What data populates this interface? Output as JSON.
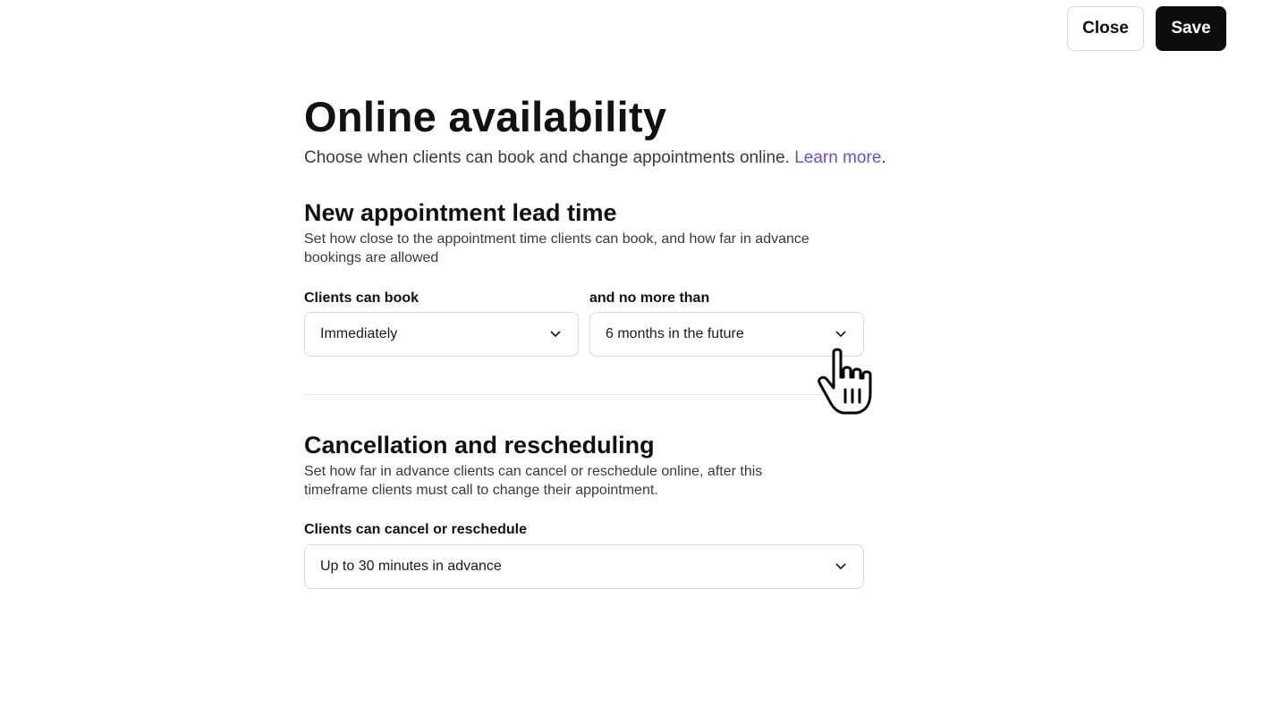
{
  "header": {
    "close_label": "Close",
    "save_label": "Save"
  },
  "page": {
    "title": "Online availability",
    "subtitle": "Choose when clients can book and change appointments online.",
    "learn_more": "Learn more",
    "subtitle_end": "."
  },
  "lead_time": {
    "title": "New appointment lead time",
    "description": "Set how close to the appointment time clients can book, and how far in advance bookings are allowed",
    "min_label": "Clients can book",
    "min_value": "Immediately",
    "max_label": "and no more than",
    "max_value": "6 months in the future"
  },
  "cancellation": {
    "title": "Cancellation and rescheduling",
    "description": "Set how far in advance clients can cancel or reschedule online, after this timeframe clients must call to change their appointment.",
    "label": "Clients can cancel or reschedule",
    "value": "Up to 30 minutes in advance"
  },
  "colors": {
    "accent_link": "#6f4cd6",
    "primary_button": "#0d0d0d",
    "border": "#d9d9d9"
  },
  "icons": {
    "dropdown": "chevron-down-icon",
    "cursor": "hand-pointer-cursor-icon"
  }
}
